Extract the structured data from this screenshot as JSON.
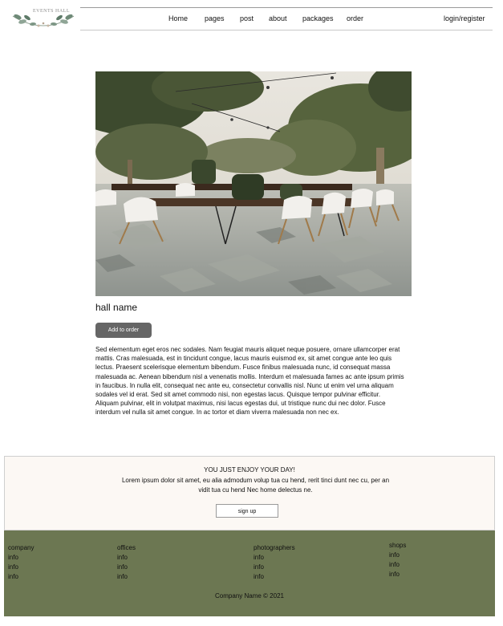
{
  "logo": {
    "text": "EVENTS HALL"
  },
  "nav": {
    "items": [
      "Home",
      "pages",
      "post",
      "about",
      "packages",
      "order"
    ],
    "login": "login/register"
  },
  "hall": {
    "image_alt": "outdoor dining tables with white chairs under string lights",
    "name": "hall name",
    "add_button": "Add to order",
    "description": "Sed elementum eget eros nec sodales. Nam feugiat mauris aliquet neque posuere, ornare ullamcorper erat mattis. Cras malesuada, est in tincidunt congue, lacus mauris euismod ex, sit amet congue ante leo quis lectus. Praesent scelerisque elementum bibendum. Fusce finibus malesuada nunc, id consequat massa malesuada ac. Aenean bibendum nisl a venenatis mollis. Interdum et malesuada fames ac ante ipsum primis in faucibus. In nulla elit, consequat nec ante eu, consectetur convallis nisl. Nunc ut enim vel urna aliquam sodales vel id erat. Sed sit amet commodo nisi, non egestas lacus. Quisque tempor pulvinar efficitur. Aliquam pulvinar, elit in volutpat maximus, nisi lacus egestas dui, ut tristique nunc dui nec dolor. Fusce interdum vel nulla sit amet congue. In ac tortor et diam viverra malesuada non nec ex."
  },
  "promo": {
    "title": "YOU JUST ENJOY YOUR DAY!",
    "text": "Lorem ipsum dolor sit amet, eu alia admodum volup tua cu hend, rerit tinci dunt nec cu, per an vidit tua cu hend Nec home delectus ne.",
    "button": "sign up"
  },
  "footer": {
    "columns": [
      {
        "title": "company",
        "items": [
          "info",
          "info",
          "info"
        ]
      },
      {
        "title": "offices",
        "items": [
          "info",
          "info",
          "info"
        ]
      },
      {
        "title": "photographers",
        "items": [
          "info",
          "info",
          "info"
        ]
      },
      {
        "title": "shops",
        "items": [
          "info",
          "info",
          "info"
        ]
      }
    ],
    "copyright": "Company Name © 2021"
  },
  "colors": {
    "footer_bg": "#6c7752",
    "promo_bg": "#fcf8f4",
    "button_bg": "#666666"
  }
}
